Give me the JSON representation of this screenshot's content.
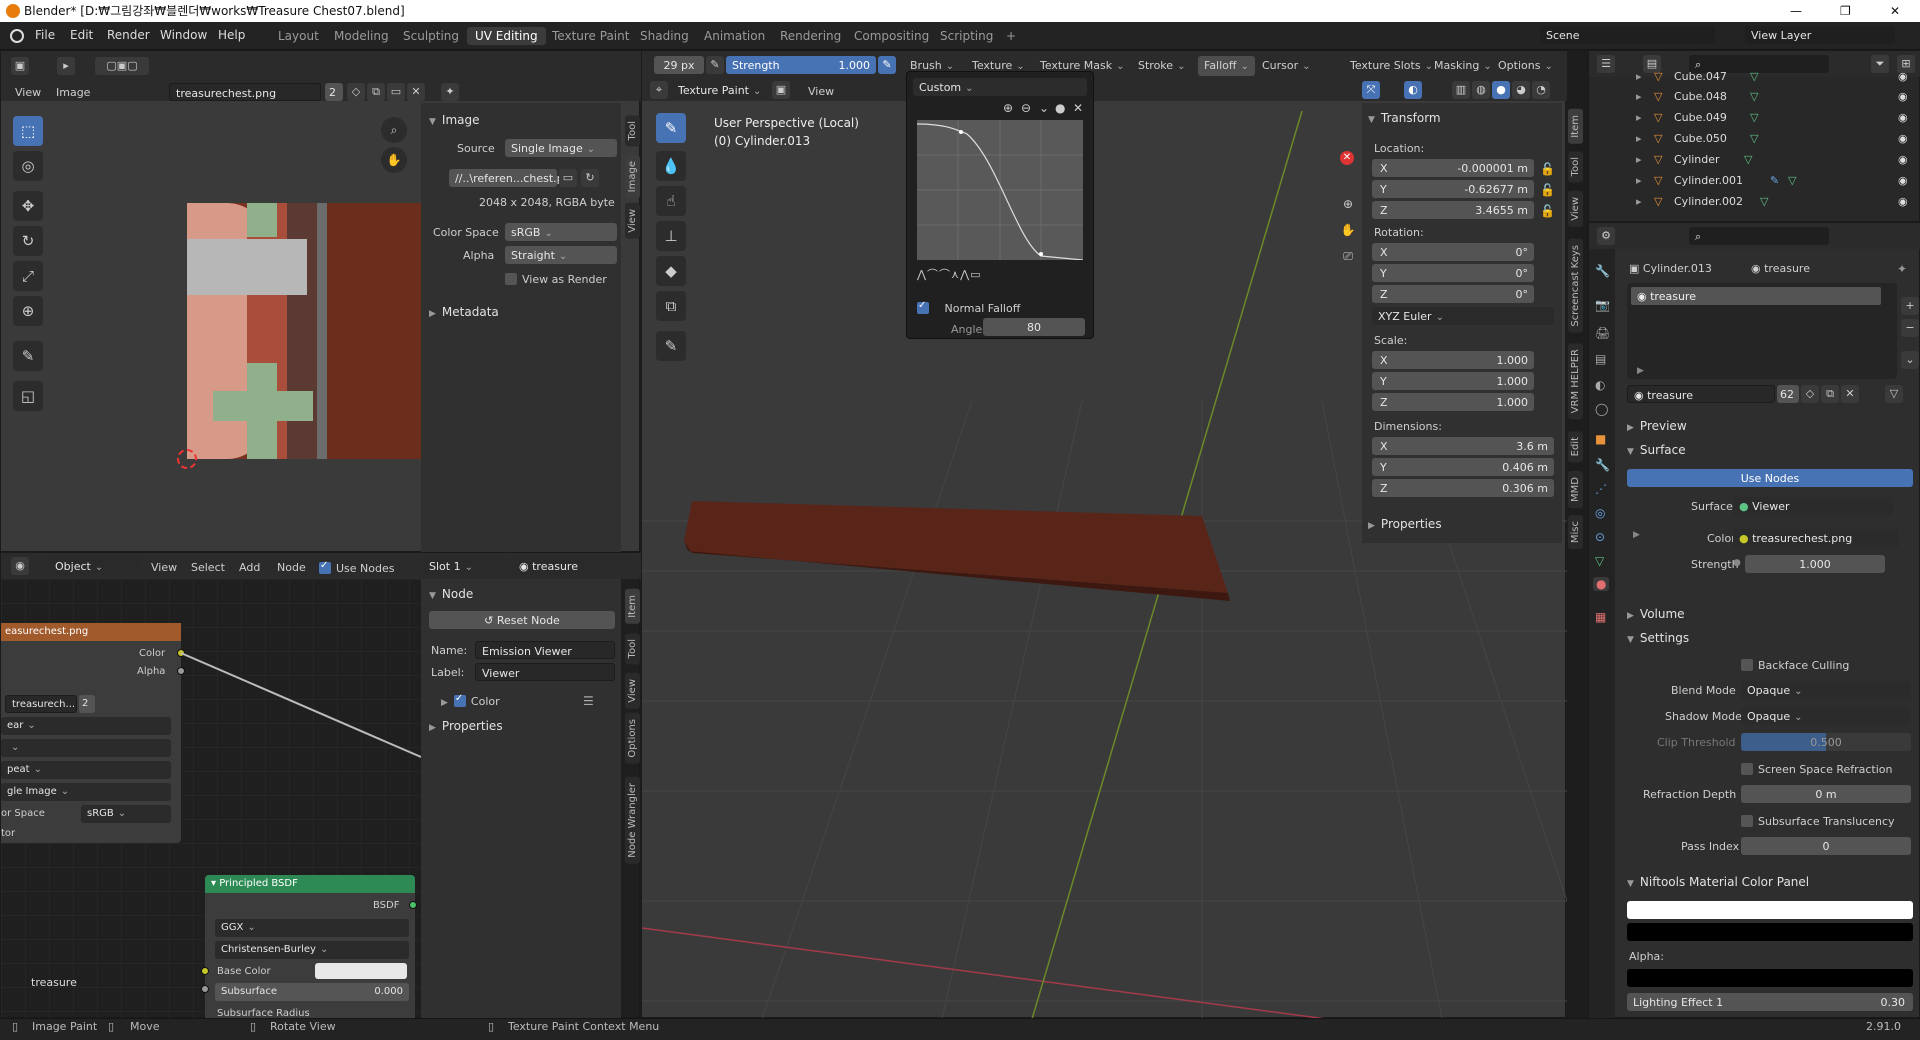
{
  "window": {
    "title": "Blender* [D:₩그림강좌₩블렌더₩works₩Treasure Chest07.blend]",
    "min": "—",
    "max": "❐",
    "close": "✕"
  },
  "menus": [
    "File",
    "Edit",
    "Render",
    "Window",
    "Help"
  ],
  "workspaces": [
    "Layout",
    "Modeling",
    "Sculpting",
    "UV Editing",
    "Texture Paint",
    "Shading",
    "Animation",
    "Rendering",
    "Compositing",
    "Scripting",
    "+"
  ],
  "scene": {
    "name": "Scene",
    "view_layer": "View Layer"
  },
  "image_editor": {
    "view": "View",
    "image": "Image",
    "image_name": "treasurechest.png",
    "users": "2",
    "panel_title": "Image",
    "source_label": "Source",
    "source_value": "Single Image",
    "filepath": "//..\\referen...chest.png",
    "info": "2048 x 2048,  RGBA byte",
    "colorspace_label": "Color Space",
    "colorspace_value": "sRGB",
    "alpha_label": "Alpha",
    "alpha_value": "Straight",
    "view_as_render": "View as Render",
    "metadata": "Metadata",
    "tabs": [
      "Tool",
      "Image",
      "View"
    ]
  },
  "node_editor": {
    "editor": "Object",
    "menus": [
      "View",
      "Select",
      "Add",
      "Node"
    ],
    "use_nodes": "Use Nodes",
    "slot": "Slot 1",
    "material": "treasure",
    "image_node": {
      "title": "easurechest.png",
      "out_color": "Color",
      "out_alpha": "Alpha",
      "img": "treasurech...",
      "users": "2",
      "rows": [
        "ear",
        "",
        "peat",
        "gle Image",
        "or Space",
        "tor"
      ],
      "colorspace": "sRGB"
    },
    "bsdf": {
      "title": "Principled BSDF",
      "out": "BSDF",
      "dist": "GGX",
      "sss": "Christensen-Burley",
      "base_color": "Base Color",
      "subsurface": "Subsurface",
      "subsurface_val": "0.000",
      "ss_radius": "Subsurface Radius"
    },
    "footer_label": "treasure",
    "side": {
      "title": "Node",
      "reset": "Reset Node",
      "name_label": "Name:",
      "name_value": "Emission Viewer",
      "label_label": "Label:",
      "label_value": "Viewer",
      "color": "Color",
      "properties": "Properties"
    },
    "tabs": [
      "Item",
      "Tool",
      "View",
      "Options",
      "Node Wrangler"
    ]
  },
  "viewport": {
    "radius": "29 px",
    "strength_label": "Strength",
    "strength_value": "1.000",
    "header_menus": [
      "Brush",
      "Texture",
      "Texture Mask",
      "Stroke",
      "Falloff",
      "Cursor"
    ],
    "right_menus": [
      "Texture Slots",
      "Masking",
      "Options"
    ],
    "mode": "Texture Paint",
    "view": "View",
    "perspective": "User Perspective (Local)",
    "object": "(0) Cylinder.013",
    "falloff": {
      "preset": "Custom",
      "normal_falloff": "Normal Falloff",
      "angle_label": "Angle",
      "angle_value": "80"
    },
    "transform": {
      "title": "Transform",
      "location": "Location:",
      "loc": [
        "-0.000001 m",
        "-0.62677 m",
        "3.4655 m"
      ],
      "rotation": "Rotation:",
      "rot": [
        "0°",
        "0°",
        "0°"
      ],
      "euler": "XYZ Euler",
      "scale": "Scale:",
      "scl": [
        "1.000",
        "1.000",
        "1.000"
      ],
      "dimensions": "Dimensions:",
      "dim": [
        "3.6 m",
        "0.406 m",
        "0.306 m"
      ],
      "properties": "Properties",
      "axes": [
        "X",
        "Y",
        "Z"
      ]
    },
    "tabs": [
      "Item",
      "Tool",
      "View",
      "Screencast Keys",
      "VRM HELPER",
      "Edit",
      "MMD",
      "Misc"
    ]
  },
  "outliner": {
    "items": [
      {
        "name": "Cube.047"
      },
      {
        "name": "Cube.048"
      },
      {
        "name": "Cube.049"
      },
      {
        "name": "Cube.050"
      },
      {
        "name": "Cylinder"
      },
      {
        "name": "Cylinder.001"
      },
      {
        "name": "Cylinder.002"
      }
    ]
  },
  "properties": {
    "object": "Cylinder.013",
    "material_top": "treasure",
    "slot": "treasure",
    "material": "treasure",
    "users": "62",
    "preview": "Preview",
    "surface": "Surface",
    "use_nodes": "Use Nodes",
    "surface_label": "Surface",
    "surface_value": "Viewer",
    "color_label": "Color",
    "color_value": "treasurechest.png",
    "strength_label": "Strength",
    "strength_value": "1.000",
    "volume": "Volume",
    "settings": "Settings",
    "backface": "Backface Culling",
    "blend_label": "Blend Mode",
    "blend_value": "Opaque",
    "shadow_label": "Shadow Mode",
    "shadow_value": "Opaque",
    "clip_label": "Clip Threshold",
    "clip_value": "0.500",
    "ssr": "Screen Space Refraction",
    "refr_label": "Refraction Depth",
    "refr_value": "0 m",
    "sss": "Subsurface Translucency",
    "pass_label": "Pass Index",
    "pass_value": "0",
    "niftools": "Niftools Material Color Panel",
    "alpha": "Alpha:",
    "lighting_label": "Lighting Effect 1",
    "lighting_value": "0.30"
  },
  "status": {
    "paint": "Image Paint",
    "move": "Move",
    "rotate": "Rotate View",
    "context": "Texture Paint Context Menu",
    "version": "2.91.0"
  },
  "colors": {
    "accent": "#4772b3",
    "wood": "#6b2d1c",
    "pink": "#d99a8a",
    "green": "#8fb08a"
  }
}
